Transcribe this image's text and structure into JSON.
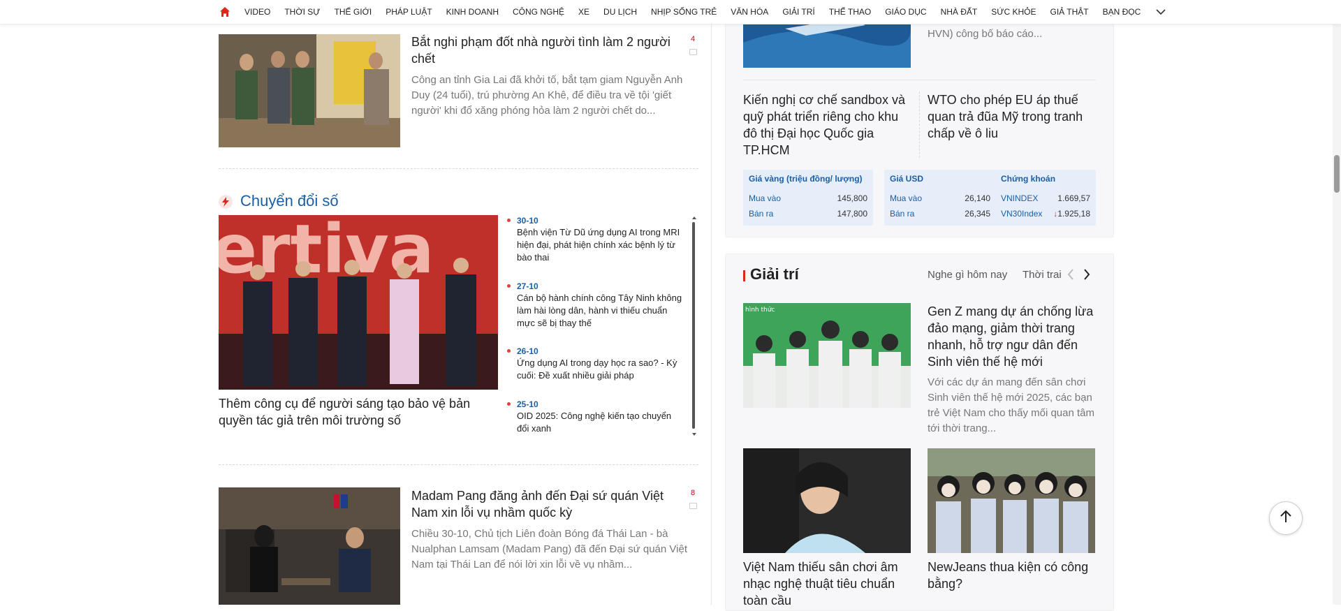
{
  "nav": {
    "items": [
      "VIDEO",
      "THỜI SỰ",
      "THẾ GIỚI",
      "PHÁP LUẬT",
      "KINH DOANH",
      "CÔNG NGHỆ",
      "XE",
      "DU LỊCH",
      "NHỊP SỐNG TRẺ",
      "VĂN HÓA",
      "GIẢI TRÍ",
      "THỂ THAO",
      "GIÁO DỤC",
      "NHÀ ĐẤT",
      "SỨC KHỎE",
      "GIẢ THẬT",
      "BẠN ĐỌC"
    ],
    "home_icon": "home-icon",
    "more_icon": "chevron-down-icon",
    "accent_color": "#e0251b"
  },
  "article1": {
    "title": "Bắt nghi phạm đốt nhà người tình làm 2 người chết",
    "sapo": "Công an tỉnh Gia Lai đã khởi tố, bắt tạm giam Nguyễn Anh Duy (24 tuổi), trú phường An Khê, để điều tra về tội 'giết người' khi đổ xăng phóng hỏa làm 2 người chết do...",
    "comments": "4"
  },
  "section": {
    "title": "Chuyển đổi số",
    "main_title": "Thêm công cụ để người sáng tạo bảo vệ bản quyền tác giả trên môi trường số",
    "banner_text": "ertiva",
    "timeline": [
      {
        "date": "30-10",
        "text": "Bệnh viện Từ Dũ ứng dụng AI trong MRI hiện đại, phát hiện chính xác bệnh lý từ bào thai"
      },
      {
        "date": "27-10",
        "text": "Cán bộ hành chính công Tây Ninh không làm hài lòng dân, hành vi thiếu chuẩn mực sẽ bị thay thế"
      },
      {
        "date": "26-10",
        "text": "Ứng dụng AI trong dạy học ra sao? - Kỳ cuối: Đề xuất nhiều giải pháp"
      },
      {
        "date": "25-10",
        "text": "OID 2025: Công nghệ kiến tạo chuyển đổi xanh"
      }
    ]
  },
  "article2": {
    "title": "Madam Pang đăng ảnh đến Đại sứ quán Việt Nam xin lỗi vụ nhầm quốc kỳ",
    "sapo": "Chiều 30-10, Chủ tịch Liên đoàn Bóng đá Thái Lan - bà Nualphan Lamsam (Madam Pang) đã đến Đại sứ quán Việt Nam tại Thái Lan để nói lời xin lỗi về vụ nhầm...",
    "comments": "8"
  },
  "business": {
    "top_sapo": "Vietnam Airlines (mã chứng khoán: HVN) công bố báo cáo...",
    "item1": "Kiến nghị cơ chế sandbox và quỹ phát triển riêng cho khu đô thị Đại học Quốc gia TP.HCM",
    "item2": "WTO cho phép EU áp thuế quan trả đũa Mỹ trong tranh chấp về ô liu",
    "gold": {
      "header": "Giá vàng (triệu đồng/ lượng)",
      "buy_label": "Mua vào",
      "buy": "145,800",
      "sell_label": "Bán ra",
      "sell": "147,800"
    },
    "usd": {
      "header": "Giá USD",
      "buy_label": "Mua vào",
      "buy": "26,140",
      "sell_label": "Bán ra",
      "sell": "26,345"
    },
    "stock": {
      "header": "Chứng khoán",
      "r1_label": "VNINDEX",
      "r1": "1.669,57",
      "r2_label": "VN30Index",
      "r2": "1.925,18"
    }
  },
  "entertainment": {
    "title": "Giải trí",
    "tabs": [
      "Nghe gì hôm nay",
      "Thời trai"
    ],
    "main_title": "Gen Z mang dự án chống lừa đảo mạng, giảm thời trang nhanh, hỗ trợ ngư dân đến Sinh viên thế hệ mới",
    "main_sapo": "Với các dự án mang đến sân chơi Sinh viên thế hệ mới 2025, các bạn trẻ Việt Nam cho thấy mối quan tâm tới thời trang...",
    "img_caption": "hình thức",
    "item1": "Việt Nam thiếu sân chơi âm nhạc nghệ thuật tiêu chuẩn toàn cầu",
    "item2": "NewJeans thua kiện có công bằng?"
  },
  "widgets": {
    "back_to_top_icon": "arrow-up-icon"
  }
}
